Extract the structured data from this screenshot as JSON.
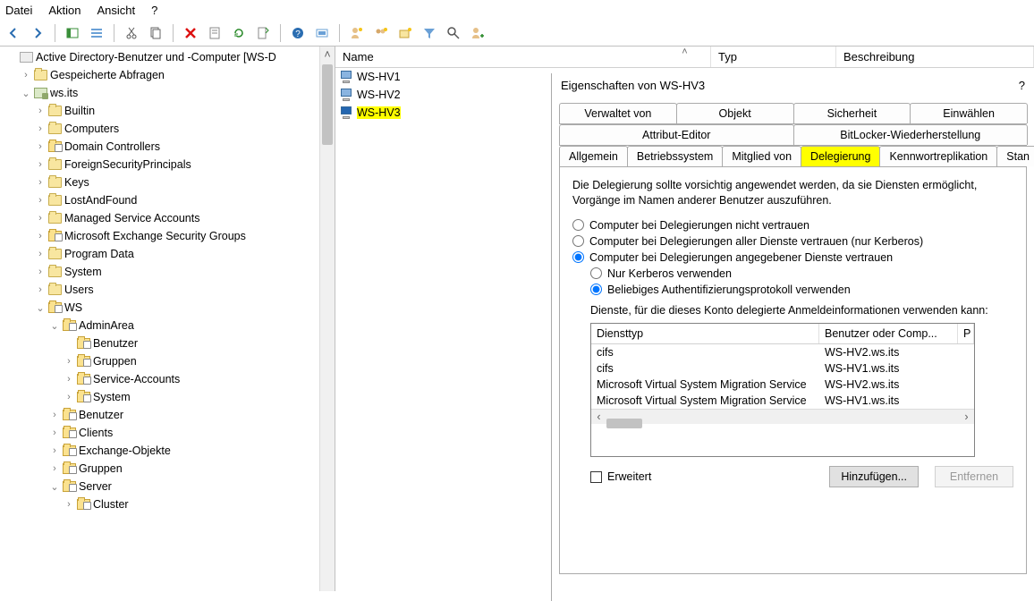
{
  "menu": {
    "file": "Datei",
    "action": "Aktion",
    "view": "Ansicht",
    "help": "?"
  },
  "tree": {
    "root": "Active Directory-Benutzer und -Computer [WS-D",
    "saved": "Gespeicherte Abfragen",
    "domain": "ws.its",
    "items": [
      "Builtin",
      "Computers",
      "Domain Controllers",
      "ForeignSecurityPrincipals",
      "Keys",
      "LostAndFound",
      "Managed Service Accounts",
      "Microsoft Exchange Security Groups",
      "Program Data",
      "System",
      "Users"
    ],
    "ws": "WS",
    "admin": "AdminArea",
    "admin_children": [
      "Benutzer",
      "Gruppen",
      "Service-Accounts",
      "System"
    ],
    "ws_children": [
      "Benutzer",
      "Clients",
      "Exchange-Objekte",
      "Gruppen"
    ],
    "server": "Server",
    "server_children": [
      "Cluster"
    ]
  },
  "list": {
    "cols": {
      "name": "Name",
      "type": "Typ",
      "desc": "Beschreibung"
    },
    "rows": [
      "WS-HV1",
      "WS-HV2",
      "WS-HV3"
    ]
  },
  "dialog": {
    "title": "Eigenschaften von WS-HV3",
    "help": "?",
    "tabs_row1": [
      "Verwaltet von",
      "Objekt",
      "Sicherheit",
      "Einwählen"
    ],
    "tabs_row2": [
      "Attribut-Editor",
      "BitLocker-Wiederherstellung"
    ],
    "tabs_row3": [
      "Allgemein",
      "Betriebssystem",
      "Mitglied von",
      "Delegierung",
      "Kennwortreplikation",
      "Stan"
    ],
    "note": "Die Delegierung sollte vorsichtig angewendet werden, da sie Diensten ermöglicht, Vorgänge im Namen anderer Benutzer auszuführen.",
    "opt1": "Computer bei Delegierungen nicht vertrauen",
    "opt2": "Computer bei Delegierungen aller Dienste vertrauen (nur Kerberos)",
    "opt3": "Computer bei Delegierungen angegebener Dienste vertrauen",
    "sub1": "Nur Kerberos verwenden",
    "sub2": "Beliebiges Authentifizierungsprotokoll verwenden",
    "sublabel": "Dienste, für die dieses Konto delegierte Anmeldeinformationen verwenden kann:",
    "svc_cols": {
      "type": "Diensttyp",
      "user": "Benutzer oder Comp...",
      "p": "P"
    },
    "services": [
      {
        "t": "cifs",
        "u": "WS-HV2.ws.its"
      },
      {
        "t": "cifs",
        "u": "WS-HV1.ws.its"
      },
      {
        "t": "Microsoft Virtual System Migration Service",
        "u": "WS-HV2.ws.its"
      },
      {
        "t": "Microsoft Virtual System Migration Service",
        "u": "WS-HV1.ws.its"
      }
    ],
    "extended": "Erweitert",
    "add": "Hinzufügen...",
    "remove": "Entfernen"
  }
}
